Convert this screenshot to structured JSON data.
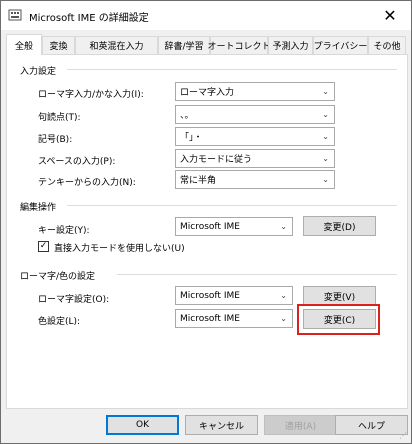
{
  "window": {
    "title": "Microsoft IME の詳細設定",
    "close_symbol": "✕",
    "app_icon": "ime-settings-icon"
  },
  "tabs": [
    {
      "label": "全般",
      "active": true
    },
    {
      "label": "変換"
    },
    {
      "label": "和英混在入力"
    },
    {
      "label": "辞書/学習"
    },
    {
      "label": "オートコレクト"
    },
    {
      "label": "予測入力"
    },
    {
      "label": "プライバシー"
    },
    {
      "label": "その他"
    }
  ],
  "input_settings": {
    "group_title": "入力設定",
    "rows": [
      {
        "label": "ローマ字入力/かな入力(I):",
        "value": "ローマ字入力"
      },
      {
        "label": "句読点(T):",
        "value": "、。"
      },
      {
        "label": "記号(B):",
        "value": "「」・"
      },
      {
        "label": "スペースの入力(P):",
        "value": "入力モードに従う"
      },
      {
        "label": "テンキーからの入力(N):",
        "value": "常に半角"
      }
    ]
  },
  "edit_ops": {
    "group_title": "編集操作",
    "key_label": "キー設定(Y):",
    "key_value": "Microsoft IME",
    "key_button": "変更(D)",
    "checkbox_label": "直接入力モードを使用しない(U)",
    "checkbox_checked": true
  },
  "romaji_color": {
    "group_title": "ローマ字/色の設定",
    "romaji_label": "ローマ字設定(O):",
    "romaji_value": "Microsoft IME",
    "romaji_button": "変更(V)",
    "color_label": "色設定(L):",
    "color_value": "Microsoft IME",
    "color_button": "変更(C)"
  },
  "footer": {
    "ok": "OK",
    "cancel": "キャンセル",
    "apply": "適用(A)",
    "help": "ヘルプ"
  },
  "colors": {
    "highlight": "#d9211e",
    "default_button_border": "#0078d7"
  }
}
